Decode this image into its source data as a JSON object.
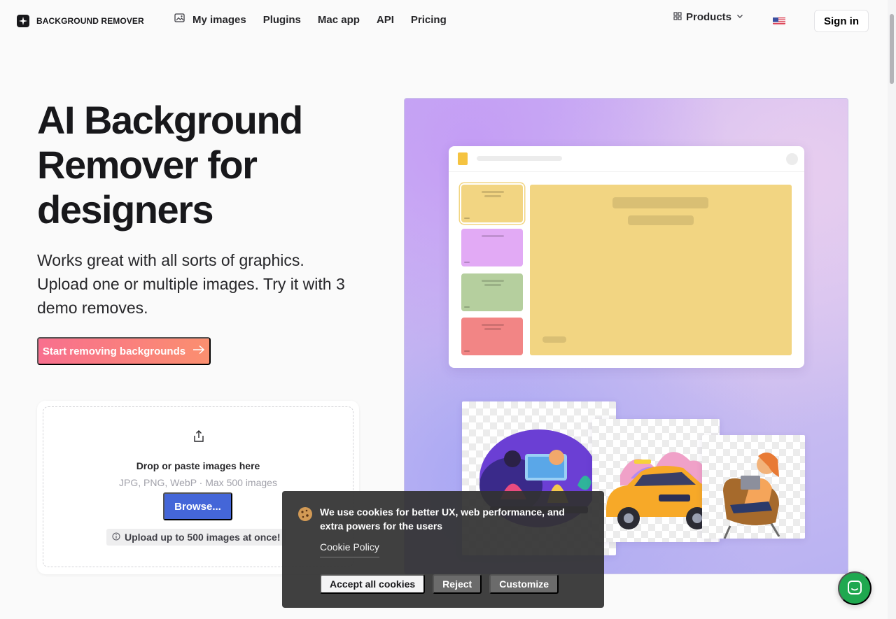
{
  "brand": {
    "name": "BACKGROUND REMOVER"
  },
  "nav": {
    "links": [
      "My images",
      "Plugins",
      "Mac app",
      "API",
      "Pricing"
    ],
    "products_label": "Products",
    "signin_label": "Sign in"
  },
  "hero": {
    "title": "AI Background Remover for designers",
    "subtitle": "Works great with all sorts of graphics. Upload one or multiple images. Try it with 3 demo removes.",
    "cta_label": "Start removing backgrounds"
  },
  "upload": {
    "title": "Drop or paste images here",
    "hint": "JPG, PNG, WebP · Max 500 images",
    "browse_label": "Browse...",
    "badge": "Upload up to 500 images at once!"
  },
  "cookie": {
    "message": "We use cookies for better UX, web performance, and extra powers for the users",
    "policy_link": "Cookie Policy",
    "accept_label": "Accept all cookies",
    "reject_label": "Reject",
    "customize_label": "Customize"
  },
  "colors": {
    "cta_start": "#f86f8e",
    "cta_end": "#fb8f6f",
    "browse": "#4466d8",
    "chat": "#1fa84f",
    "thumbs": [
      "#f2d582",
      "#e2aaf5",
      "#b5cf9e",
      "#f28585"
    ]
  }
}
